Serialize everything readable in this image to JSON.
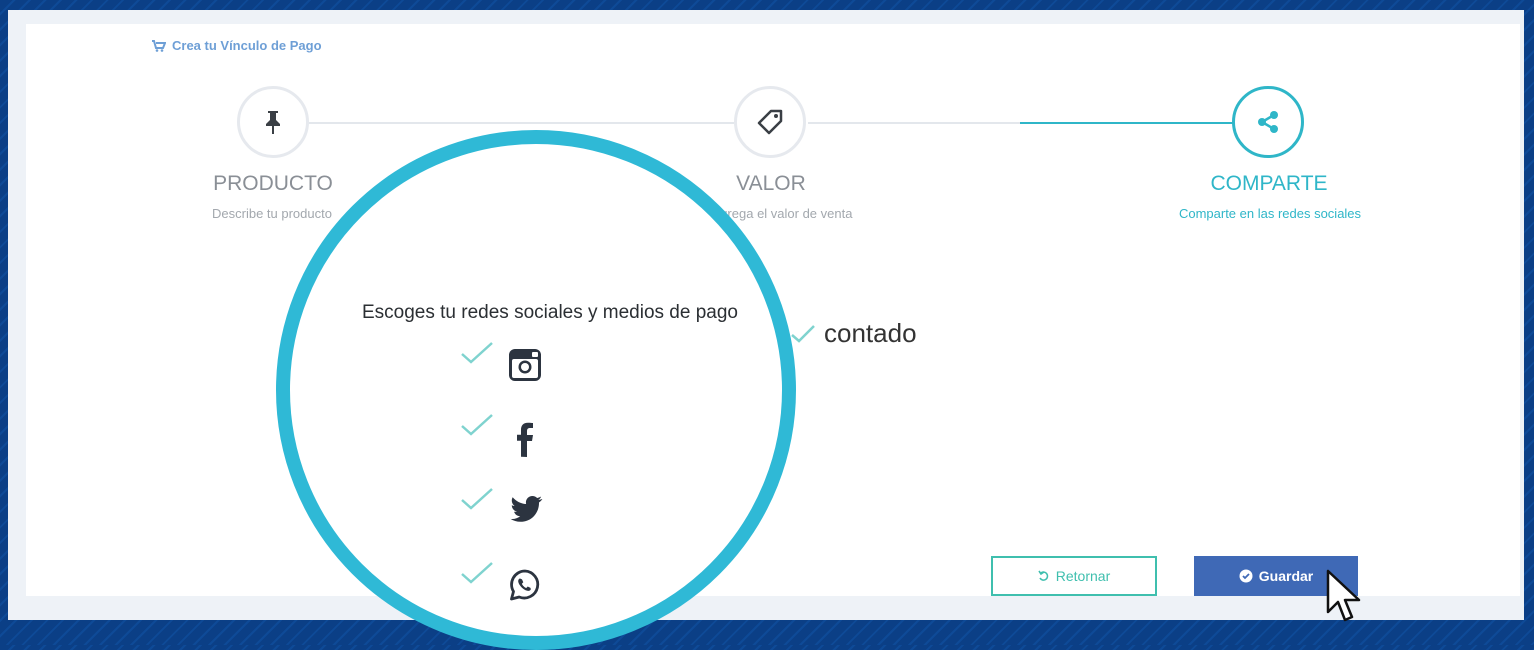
{
  "breadcrumb": {
    "label": "Crea tu Vínculo de Pago"
  },
  "steps": [
    {
      "title": "PRODUCTO",
      "subtitle": "Describe tu producto",
      "icon": "pin-icon",
      "active": false
    },
    {
      "title": "VALOR",
      "subtitle": "Agrega el valor de venta",
      "icon": "tag-icon",
      "active": false
    },
    {
      "title": "COMPARTE",
      "subtitle": "Comparte en las redes sociales",
      "icon": "share-icon",
      "active": true
    }
  ],
  "magnifier": {
    "title": "Escoges tu redes sociales y medios de pago",
    "socials": [
      {
        "name": "instagram",
        "icon": "instagram-icon",
        "checked": true
      },
      {
        "name": "facebook",
        "icon": "facebook-icon",
        "checked": true
      },
      {
        "name": "twitter",
        "icon": "twitter-icon",
        "checked": true
      },
      {
        "name": "whatsapp",
        "icon": "whatsapp-icon",
        "checked": true
      }
    ]
  },
  "payment": {
    "option_label": "contado",
    "checked": true
  },
  "buttons": {
    "return_label": "Retornar",
    "save_label": "Guardar"
  },
  "colors": {
    "accent": "#2fb6c8",
    "primary_button": "#3f69b6",
    "return_border": "#3fbfae",
    "background": "#0b3f86"
  }
}
